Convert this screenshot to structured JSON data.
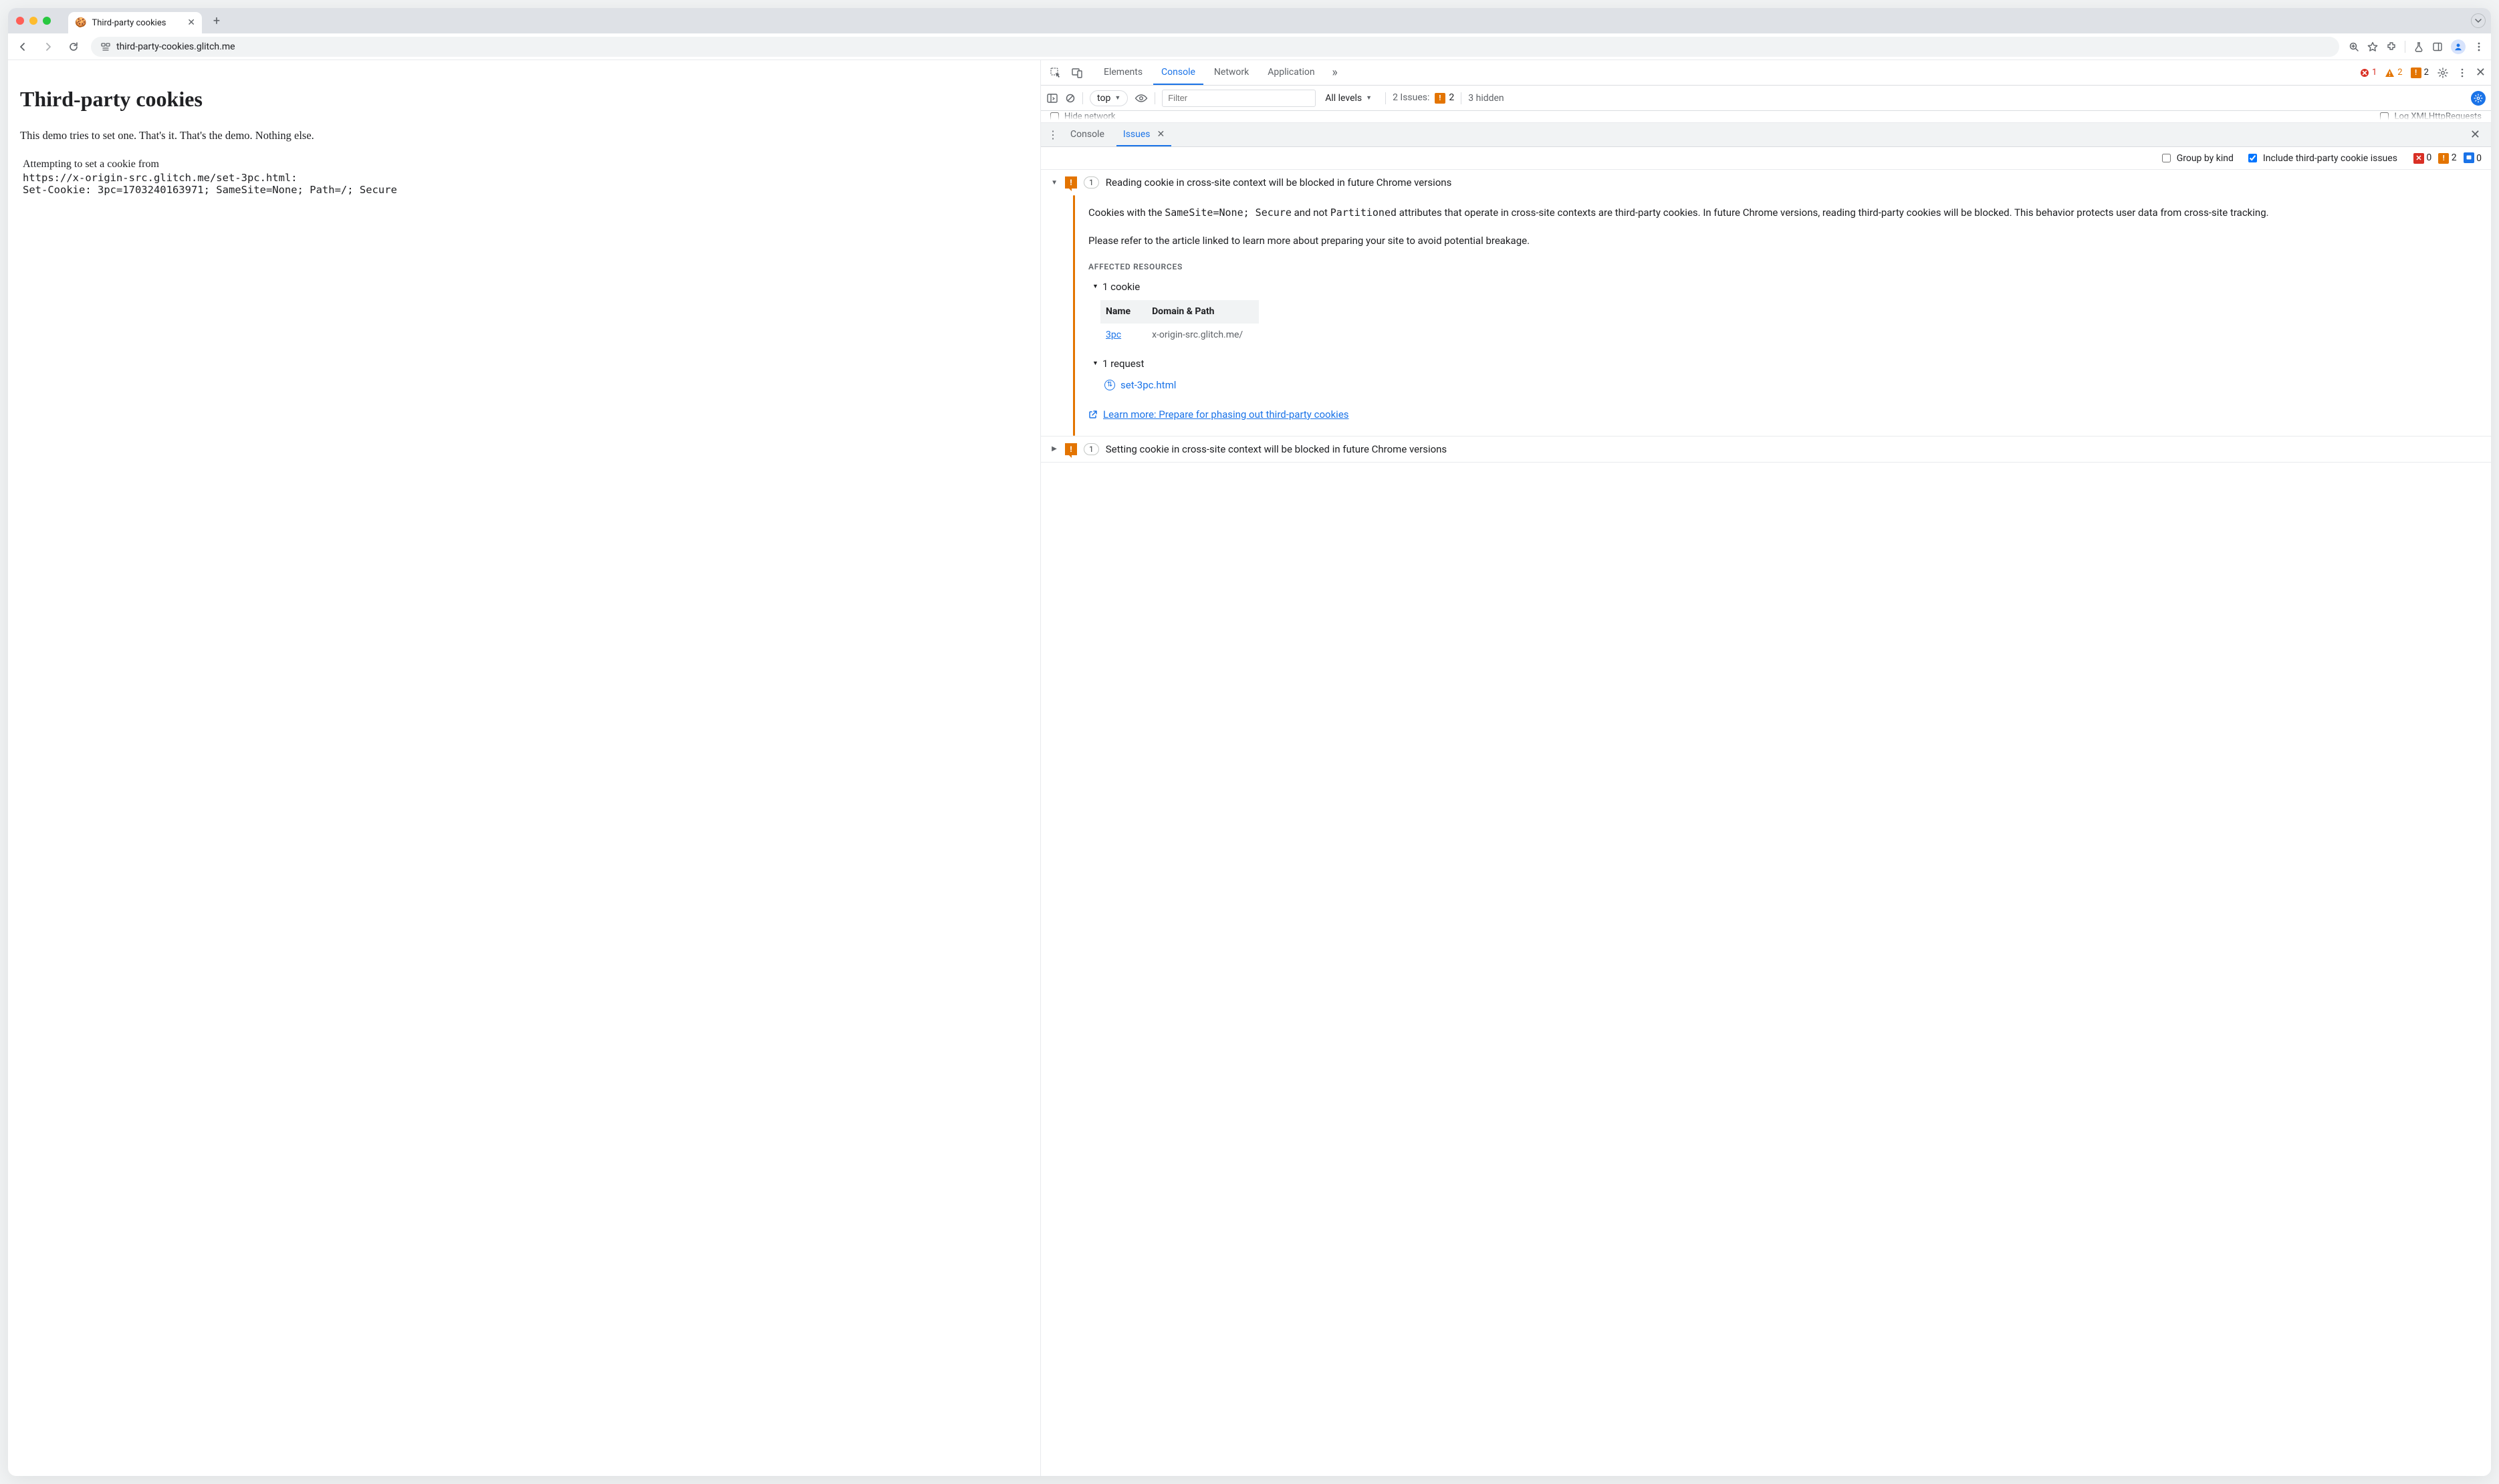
{
  "browser": {
    "tab_title": "Third-party cookies",
    "tab_favicon": "🍪",
    "url": "third-party-cookies.glitch.me"
  },
  "page": {
    "h1": "Third-party cookies",
    "body": "This demo tries to set one. That's it. That's the demo. Nothing else.",
    "attempt_label": "Attempting to set a cookie from",
    "code": "https://x-origin-src.glitch.me/set-3pc.html:\nSet-Cookie: 3pc=1703240163971; SameSite=None; Path=/; Secure"
  },
  "devtools": {
    "tabs": {
      "elements": "Elements",
      "console": "Console",
      "network": "Network",
      "application": "Application"
    },
    "top_err_count": "1",
    "top_warn_count": "2",
    "top_breaking_count": "2",
    "filterbar": {
      "context_label": "top",
      "filter_placeholder": "Filter",
      "levels_label": "All levels",
      "issues_label": "2 Issues:",
      "issues_count": "2",
      "hidden_label": "3 hidden"
    },
    "hidden_row": {
      "left": "Hide network",
      "right": "Log XMLHttpRequests"
    },
    "drawer": {
      "console_label": "Console",
      "issues_label": "Issues"
    },
    "issues_bar": {
      "group_label": "Group by kind",
      "include_label": "Include third-party cookie issues",
      "err": "0",
      "warn": "2",
      "info": "0"
    },
    "issue1": {
      "count": "1",
      "title": "Reading cookie in cross-site context will be blocked in future Chrome versions",
      "para1_prefix": "Cookies with the ",
      "para1_code1": "SameSite=None; Secure",
      "para1_mid": " and not ",
      "para1_code2": "Partitioned",
      "para1_suffix": " attributes that operate in cross-site contexts are third-party cookies. In future Chrome versions, reading third-party cookies will be blocked. This behavior protects user data from cross-site tracking.",
      "para2": "Please refer to the article linked to learn more about preparing your site to avoid potential breakage.",
      "affected_label": "AFFECTED RESOURCES",
      "cookie_section": "1 cookie",
      "th_name": "Name",
      "th_domain": "Domain & Path",
      "cookie_name": "3pc",
      "cookie_domain": "x-origin-src.glitch.me/",
      "request_section": "1 request",
      "request_link": "set-3pc.html",
      "learn_more": "Learn more: Prepare for phasing out third-party cookies"
    },
    "issue2": {
      "count": "1",
      "title": "Setting cookie in cross-site context will be blocked in future Chrome versions"
    }
  }
}
